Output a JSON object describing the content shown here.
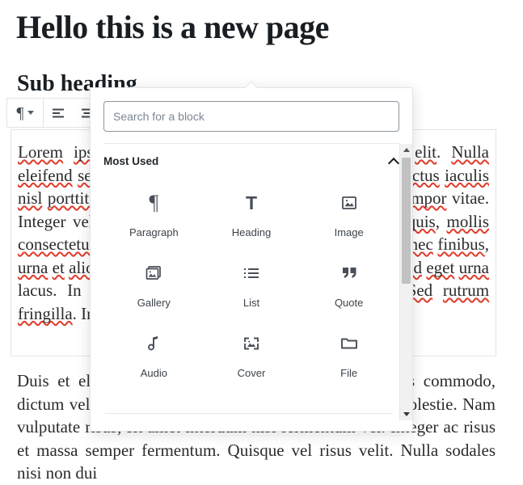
{
  "document": {
    "title": "Hello this is a new page",
    "sub_heading": "Sub heading",
    "paragraph_one": "Lorem ipsum dolor sit amet, consectetur adipiscing elit. Nulla eleifend sed leo dapibus gravida. Nullam vitae nisl vel lectus iaculis nisl porttitor quis. Praesent ac felis sed urna dignissim tempor vitae. Integer vel lacus id purus volutpat sagittis at at tortor quis, mollis consectetur risus. Nunc sit amet sem quis quis elementum. Donec finibus, urna et aliquam purus, eu lacinia enim lorem vitae nisi. Sed eget urna lacus. In non vestibulum nisl, vel consectetur elit. Sed rutrum fringilla. In gravida mollis faucibus orci.",
    "paragraph_two": "Duis et elit in lacus tristique faucibus vitae quis risus commodo, dictum velit id, consequat ipsum, quis vestibulum nisl molestie. Nam vulputate risus, sit amet interdum nisi fermentum vel. Integer ac risus et massa semper fermentum. Quisque vel risus velit. Nulla sodales nisi non dui"
  },
  "block_toolbar": {
    "block_type_label": "¶",
    "block_type_title": "Change block type",
    "align_left_title": "Align text left",
    "align_center_title": "Align text center"
  },
  "inserter": {
    "search": {
      "placeholder": "Search for a block",
      "value": ""
    },
    "panel": {
      "title": "Most Used",
      "collapsed": false
    },
    "blocks": [
      {
        "label": "Paragraph",
        "icon": "paragraph-icon"
      },
      {
        "label": "Heading",
        "icon": "heading-icon"
      },
      {
        "label": "Image",
        "icon": "image-icon"
      },
      {
        "label": "Gallery",
        "icon": "gallery-icon"
      },
      {
        "label": "List",
        "icon": "list-icon"
      },
      {
        "label": "Quote",
        "icon": "quote-icon"
      },
      {
        "label": "Audio",
        "icon": "audio-icon"
      },
      {
        "label": "Cover",
        "icon": "cover-icon"
      },
      {
        "label": "File",
        "icon": "file-icon"
      }
    ]
  },
  "colors": {
    "border": "#e2e4e7",
    "text": "#191e23",
    "muted": "#7b8794",
    "spellcheck_underline": "#e03e2d",
    "scrollbar_track": "#f1f1f1",
    "scrollbar_thumb": "#c1c1c1"
  }
}
